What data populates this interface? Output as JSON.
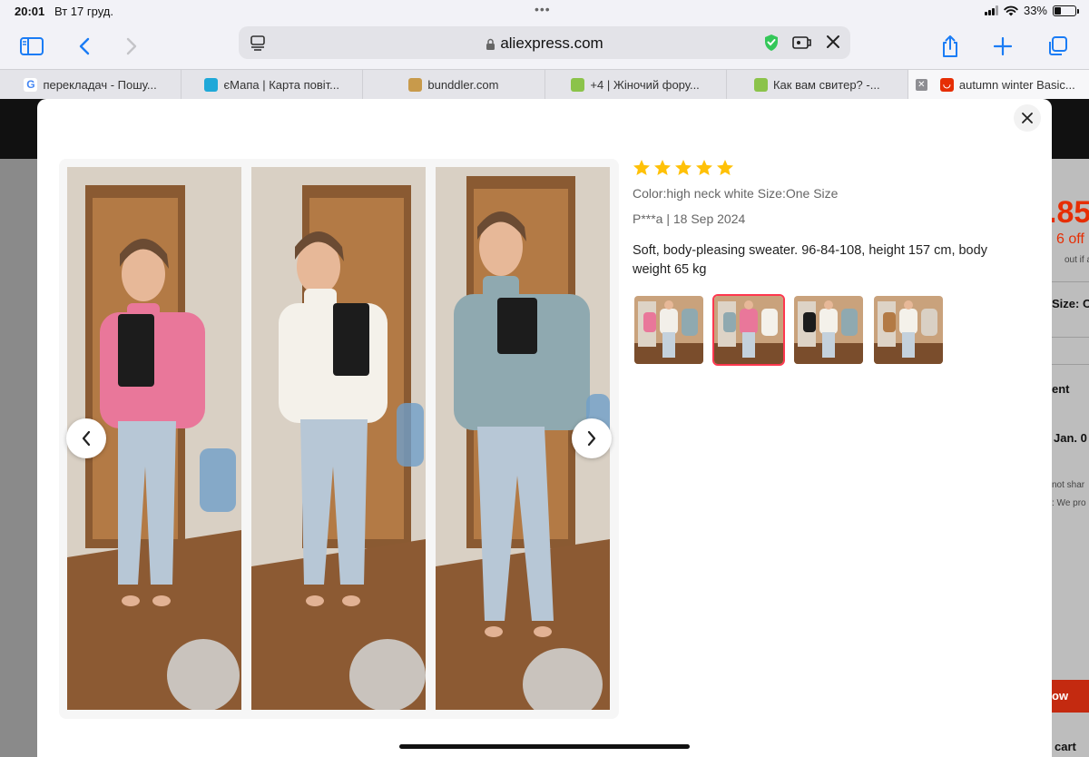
{
  "status_bar": {
    "time": "20:01",
    "date": "Вт 17 груд.",
    "battery": "33%",
    "battery_level": 0.33
  },
  "browser": {
    "url": "aliexpress.com",
    "tabs": [
      {
        "label": "перекладач - Пошу...",
        "favicon": "google-icon"
      },
      {
        "label": "єМапа | Карта повіт...",
        "favicon": "emapa-icon"
      },
      {
        "label": "bunddler.com",
        "favicon": "box-icon"
      },
      {
        "label": "+4 | Жіночий фору...",
        "favicon": "forum-icon"
      },
      {
        "label": "Как вам свитер? -...",
        "favicon": "forum-icon"
      },
      {
        "label": "autumn winter Basic...",
        "favicon": "aliexpress-icon",
        "active": true
      }
    ]
  },
  "background_page": {
    "price_fragment": ".85",
    "off_fragment": "6 off",
    "but_fragment": "out if app",
    "size_fragment": "Size: O",
    "ent_fragment": "ent",
    "jan_fragment": "Jan. 0",
    "notshar_fragment": "not shar",
    "wepro_fragment": ": We pro",
    "buy_fragment": "ow",
    "cart_fragment": "cart"
  },
  "review": {
    "rating": 5,
    "sku": "Color:high neck white Size:One Size",
    "author_date": "P***a | 18 Sep 2024",
    "text": "Soft, body-pleasing sweater. 96-84-108, height 157 cm, body weight 65 kg",
    "photos": [
      {
        "sweater_color": "#e9779a"
      },
      {
        "sweater_color": "#f4f1ea"
      },
      {
        "sweater_color": "#8fa9b0"
      }
    ],
    "thumbnails": [
      {
        "selected": false
      },
      {
        "selected": true
      },
      {
        "selected": false
      },
      {
        "selected": false
      }
    ]
  },
  "colors": {
    "accent": "#fd384f",
    "star": "#ffc107",
    "brand_red": "#e62e04"
  }
}
